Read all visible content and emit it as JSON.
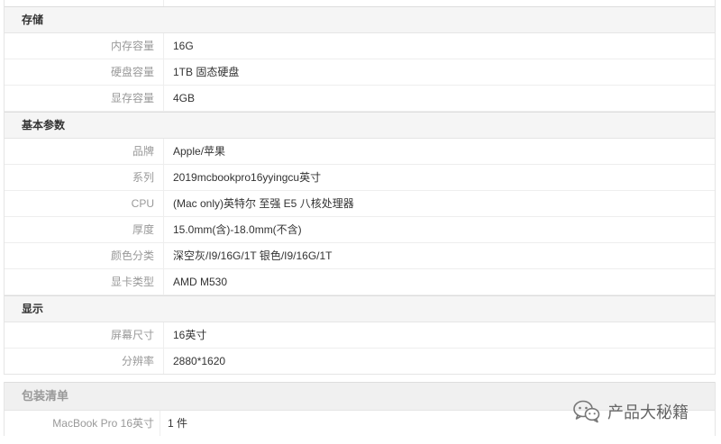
{
  "groups": [
    {
      "title": "存储",
      "rows": [
        {
          "k": "内存容量",
          "v": "16G"
        },
        {
          "k": "硬盘容量",
          "v": "1TB 固态硬盘"
        },
        {
          "k": "显存容量",
          "v": "4GB"
        }
      ]
    },
    {
      "title": "基本参数",
      "rows": [
        {
          "k": "品牌",
          "v": "Apple/苹果"
        },
        {
          "k": "系列",
          "v": "2019mcbookpro16yyingcu英寸"
        },
        {
          "k": "CPU",
          "v": "(Mac only)英特尔 至强 E5 八核处理器"
        },
        {
          "k": "厚度",
          "v": "15.0mm(含)-18.0mm(不含)"
        },
        {
          "k": "颜色分类",
          "v": "深空灰/I9/16G/1T 银色/I9/16G/1T"
        },
        {
          "k": "显卡类型",
          "v": "AMD M530"
        }
      ]
    },
    {
      "title": "显示",
      "rows": [
        {
          "k": "屏幕尺寸",
          "v": "16英寸"
        },
        {
          "k": "分辨率",
          "v": "2880*1620"
        }
      ]
    }
  ],
  "pack": {
    "title": "包装清单",
    "rows": [
      {
        "k": "MacBook Pro 16英寸",
        "v": "1 件"
      }
    ]
  },
  "watermark": {
    "text": "产品大秘籍",
    "icon": "wechat-icon"
  }
}
